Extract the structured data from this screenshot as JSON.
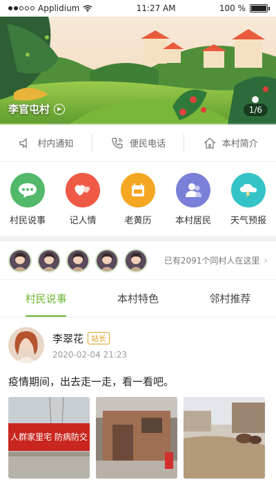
{
  "status": {
    "carrier": "Applidium",
    "time": "11:27 AM",
    "battery": "100 %",
    "battery_level": 1.0
  },
  "banner": {
    "village_name": "李官屯村",
    "counter": "1/6",
    "slide_fraction": 0.1667
  },
  "quicklinks": [
    {
      "label": "村内通知",
      "icon": "speaker-icon"
    },
    {
      "label": "便民电话",
      "icon": "phone-icon"
    },
    {
      "label": "本村简介",
      "icon": "home-icon"
    }
  ],
  "features": [
    {
      "label": "村民说事",
      "icon": "chat-icon",
      "color": "#52b86a"
    },
    {
      "label": "记人情",
      "icon": "hearts-icon",
      "color": "#ee5a45"
    },
    {
      "label": "老黄历",
      "icon": "calendar-icon",
      "color": "#f5a623"
    },
    {
      "label": "本村居民",
      "icon": "people-icon",
      "color": "#7a7fd8"
    },
    {
      "label": "天气预报",
      "icon": "weather-icon",
      "color": "#34c3c7"
    }
  ],
  "villagers": {
    "text": "已有2091个同村人在这里"
  },
  "tabs": [
    {
      "label": "村民说事",
      "active": true
    },
    {
      "label": "本村特色",
      "active": false
    },
    {
      "label": "邻村推荐",
      "active": false
    }
  ],
  "post": {
    "author": "李翠花",
    "role": "站长",
    "time": "2020-02-04 21:23",
    "text": "疫情期间，出去走一走，看一看吧。",
    "photo_banner_text": "人群家里宅 防病防交"
  },
  "colors": {
    "accent": "#6bb42e"
  }
}
